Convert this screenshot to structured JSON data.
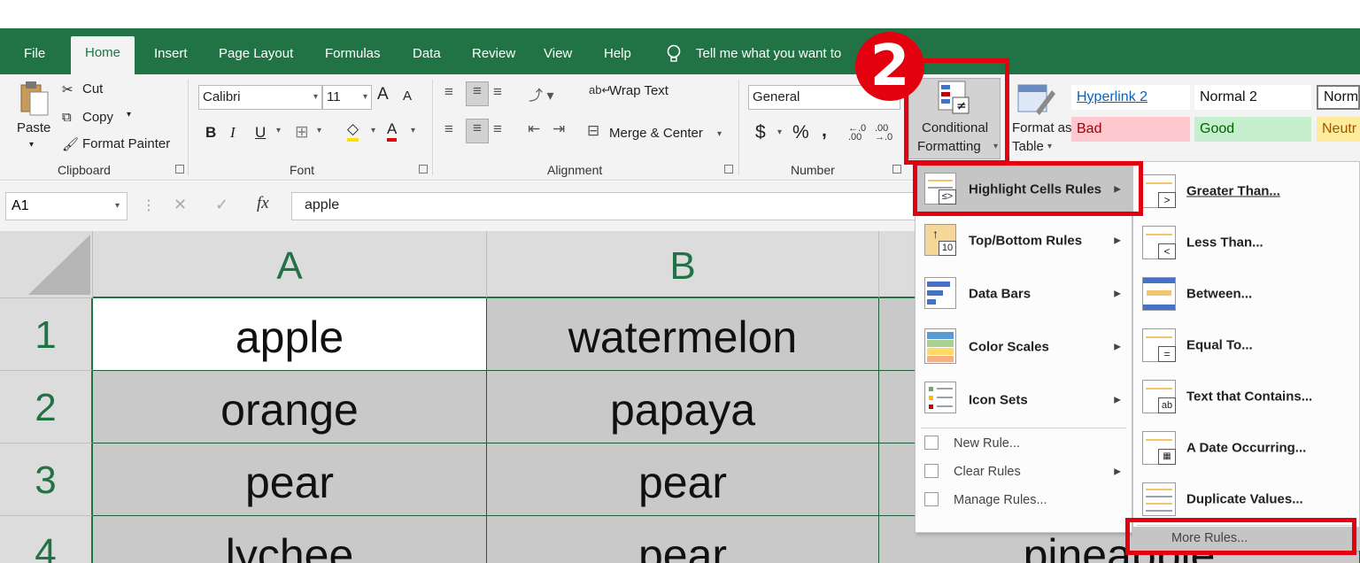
{
  "tabs": [
    "File",
    "Home",
    "Insert",
    "Page Layout",
    "Formulas",
    "Data",
    "Review",
    "View",
    "Help"
  ],
  "tell_me": "Tell me what you want to",
  "clipboard": {
    "paste": "Paste",
    "cut": "Cut",
    "copy": "Copy",
    "format_painter": "Format Painter",
    "group": "Clipboard"
  },
  "font": {
    "name": "Calibri",
    "size": "11",
    "group": "Font",
    "bold": "B",
    "italic": "I",
    "underline": "U",
    "grow": "A",
    "shrink": "A",
    "font_color": "A"
  },
  "alignment": {
    "wrap": "Wrap Text",
    "merge": "Merge & Center",
    "group": "Alignment"
  },
  "number": {
    "format": "General",
    "currency": "$",
    "percent": "%",
    "comma": ",",
    "group": "Number"
  },
  "styles_group": {
    "conditional_line1": "Conditional",
    "conditional_line2": "Formatting",
    "format_table_line1": "Format as",
    "format_table_line2": "Table",
    "cells": [
      {
        "label": "Hyperlink 2",
        "bg": "#ffffff",
        "color": "#0563c1"
      },
      {
        "label": "Normal 2",
        "bg": "#ffffff",
        "color": "#111111"
      },
      {
        "label": "Norm",
        "bg": "#ffffff",
        "color": "#111111"
      },
      {
        "label": "Bad",
        "bg": "#ffc7ce",
        "color": "#9c0006"
      },
      {
        "label": "Good",
        "bg": "#c6efce",
        "color": "#006100"
      },
      {
        "label": "Neutr",
        "bg": "#ffeb9c",
        "color": "#9c5700"
      }
    ]
  },
  "formula_bar": {
    "name_box": "A1",
    "value": "apple",
    "fx": "fx"
  },
  "columns": [
    "A",
    "B"
  ],
  "rows": [
    {
      "num": "1",
      "a": "apple",
      "b": "watermelon",
      "c": ""
    },
    {
      "num": "2",
      "a": "orange",
      "b": "papaya",
      "c": ""
    },
    {
      "num": "3",
      "a": "pear",
      "b": "pear",
      "c": ""
    },
    {
      "num": "4",
      "a": "lychee",
      "b": "pear",
      "c": "pineapple"
    }
  ],
  "cf_menu": {
    "items": [
      "Highlight Cells Rules",
      "Top/Bottom Rules",
      "Data Bars",
      "Color Scales",
      "Icon Sets"
    ],
    "small_items": [
      "New Rule...",
      "Clear Rules",
      "Manage Rules..."
    ]
  },
  "highlight_submenu": {
    "items": [
      "Greater Than...",
      "Less Than...",
      "Between...",
      "Equal To...",
      "Text that Contains...",
      "A Date Occurring...",
      "Duplicate Values..."
    ],
    "more": "More Rules..."
  },
  "step_badge": "2",
  "colors": {
    "accent": "#217346",
    "highlight": "#e3000f"
  }
}
